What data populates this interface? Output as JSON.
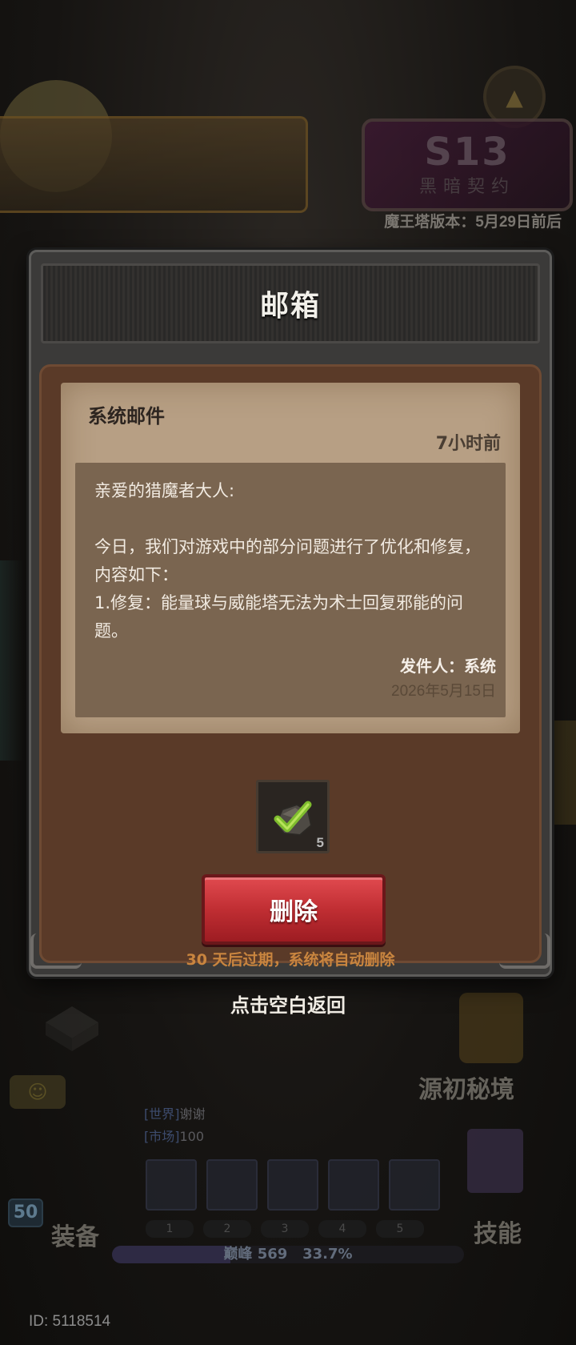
{
  "background": {
    "season": {
      "number": "S13",
      "name": "黑暗契约"
    },
    "tower_version": "魔王塔版本：5月29日前后",
    "hud": {
      "equip_label": "装备",
      "skill_label": "技能",
      "secret_realm_label": "源初秘境",
      "level": "50",
      "chat_lines": [
        {
          "channel": "[世界]",
          "text": "谢谢"
        },
        {
          "channel": "[市场]",
          "text": "100"
        }
      ],
      "slot_numbers": [
        "1",
        "2",
        "3",
        "4",
        "5"
      ],
      "xp": {
        "label": "巅峰",
        "value": "569",
        "percent_text": "33.7%",
        "percent": 33.7
      },
      "player_id": "ID: 5118514"
    }
  },
  "mailbox": {
    "title": "邮箱",
    "mail": {
      "type": "系统邮件",
      "received": "7小时前",
      "greeting": "亲爱的猎魔者大人:",
      "paragraph1": "今日，我们对游戏中的部分问题进行了优化和修复，内容如下：",
      "paragraph2": "1.修复：能量球与威能塔无法为术士回复邪能的问题。",
      "sender": "发件人：系统",
      "date": "2026年5月15日"
    },
    "attachment": {
      "icon": "checkmark-ore-icon",
      "quantity": "5"
    },
    "delete_label": "删除",
    "expire_note": "30 天后过期，系统将自动删除",
    "dismiss_hint": "点击空白返回"
  }
}
